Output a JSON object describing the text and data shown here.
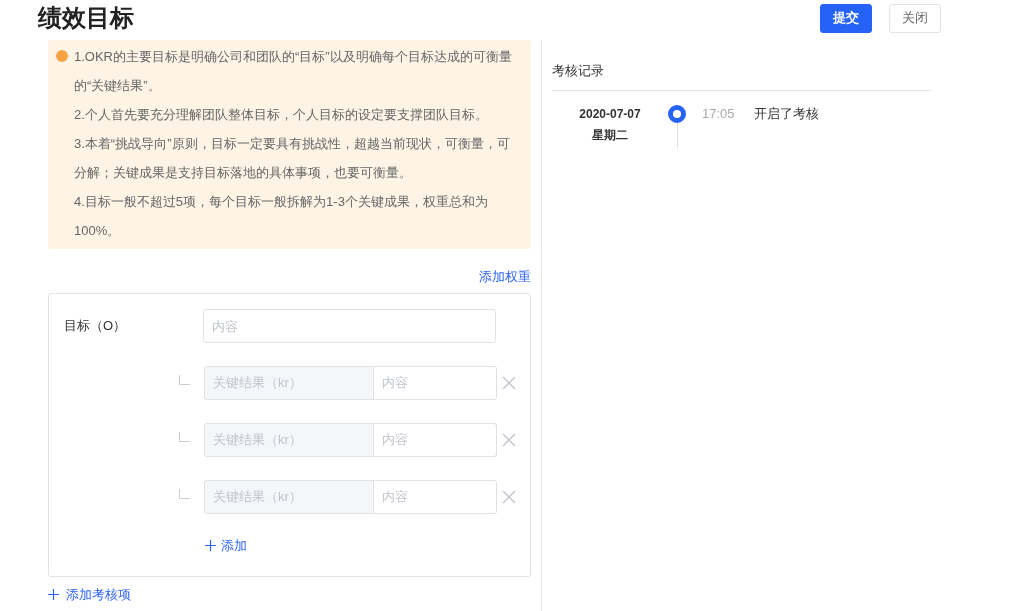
{
  "title": "绩效目标",
  "buttons": [
    {
      "label": "提交",
      "kind": "primary"
    },
    {
      "label": "关闭",
      "kind": "default"
    }
  ],
  "notice": {
    "lines": [
      "1.OKR的主要目标是明确公司和团队的“目标”以及明确每个目标达成的可衡量的“关键结果”。",
      "2.个人首先要充分理解团队整体目标，个人目标的设定要支撑团队目标。",
      "3.本着“挑战导向”原则，目标一定要具有挑战性，超越当前现状，可衡量，可分解；关键成果是支持目标落地的具体事项，也要可衡量。",
      "4.目标一般不超过5项，每个目标一般拆解为1-3个关键成果，权重总和为100%。"
    ]
  },
  "add_weight_link": "添加权重",
  "objective": {
    "label": "目标（O）",
    "placeholder": "内容",
    "key_results": [
      {
        "label": "关键结果（kr）",
        "placeholder": "内容"
      },
      {
        "label": "关键结果（kr）",
        "placeholder": "内容"
      },
      {
        "label": "关键结果（kr）",
        "placeholder": "内容"
      }
    ],
    "add_label": "添加"
  },
  "add_item_link": "添加考核项",
  "record": {
    "title": "考核记录",
    "entries": [
      {
        "date": "2020-07-07",
        "weekday": "星期二",
        "time": "17:05",
        "text": "开启了考核"
      }
    ]
  }
}
